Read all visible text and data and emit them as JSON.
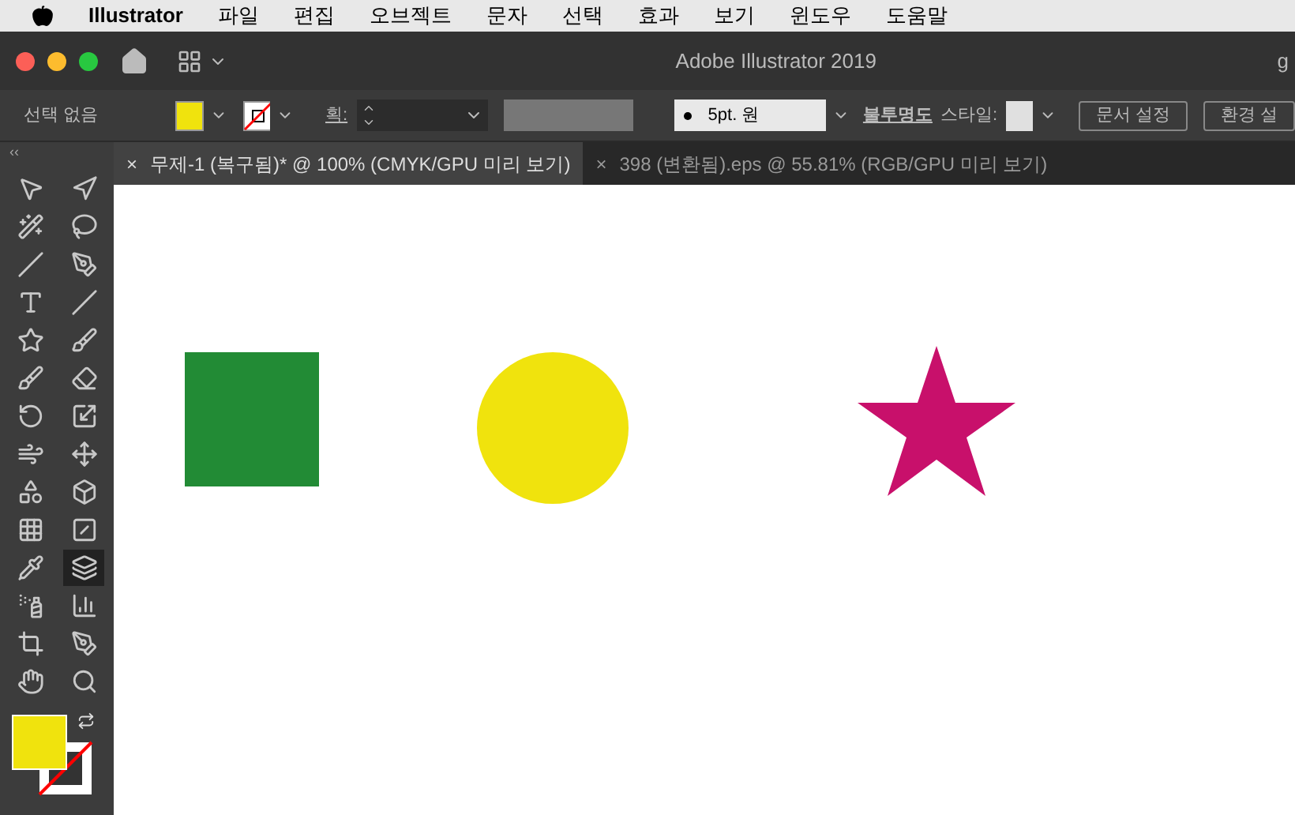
{
  "menu_bar": {
    "app_name": "Illustrator",
    "items": [
      "파일",
      "편집",
      "오브젝트",
      "문자",
      "선택",
      "효과",
      "보기",
      "윈도우",
      "도움말"
    ]
  },
  "window": {
    "title": "Adobe Illustrator 2019",
    "right_text": "g"
  },
  "control_bar": {
    "selection": "선택 없음",
    "stroke_label": "획:",
    "brush": "5pt. 원",
    "opacity_label": "불투명도",
    "style_label": "스타일:",
    "buttons": [
      "문서 설정",
      "환경 설"
    ]
  },
  "collapse_glyph": "‹‹",
  "tabs": [
    {
      "label": "무제-1 (복구됨)* @ 100% (CMYK/GPU 미리 보기)",
      "selected": true,
      "close": "×"
    },
    {
      "label": "398 (변환됨).eps @ 55.81% (RGB/GPU 미리 보기)",
      "selected": false,
      "close": "×"
    }
  ],
  "tools": [
    {
      "kind": "select",
      "selected": false
    },
    {
      "kind": "direct",
      "selected": false
    },
    {
      "kind": "wand",
      "selected": false
    },
    {
      "kind": "lasso",
      "selected": false
    },
    {
      "kind": "anchor",
      "selected": false
    },
    {
      "kind": "pen",
      "selected": false
    },
    {
      "kind": "type",
      "selected": false
    },
    {
      "kind": "line",
      "selected": false
    },
    {
      "kind": "star",
      "selected": false
    },
    {
      "kind": "brush",
      "selected": false
    },
    {
      "kind": "blob",
      "selected": false
    },
    {
      "kind": "eraser",
      "selected": false
    },
    {
      "kind": "rotate",
      "selected": false
    },
    {
      "kind": "scale",
      "selected": false
    },
    {
      "kind": "warp",
      "selected": false
    },
    {
      "kind": "transform",
      "selected": false
    },
    {
      "kind": "builder",
      "selected": false
    },
    {
      "kind": "perspective",
      "selected": false
    },
    {
      "kind": "mesh",
      "selected": false
    },
    {
      "kind": "gradient",
      "selected": false
    },
    {
      "kind": "eyedropper",
      "selected": false
    },
    {
      "kind": "shapes",
      "selected": true
    },
    {
      "kind": "spray",
      "selected": false
    },
    {
      "kind": "graph",
      "selected": false
    },
    {
      "kind": "artboard",
      "selected": false
    },
    {
      "kind": "knife",
      "selected": false
    },
    {
      "kind": "hand",
      "selected": false
    },
    {
      "kind": "zoom",
      "selected": false
    }
  ],
  "shapes": [
    {
      "kind": "square",
      "color": "#228b35"
    },
    {
      "kind": "circle",
      "color": "#f0e30d"
    },
    {
      "kind": "star",
      "color": "#c8106b"
    }
  ]
}
